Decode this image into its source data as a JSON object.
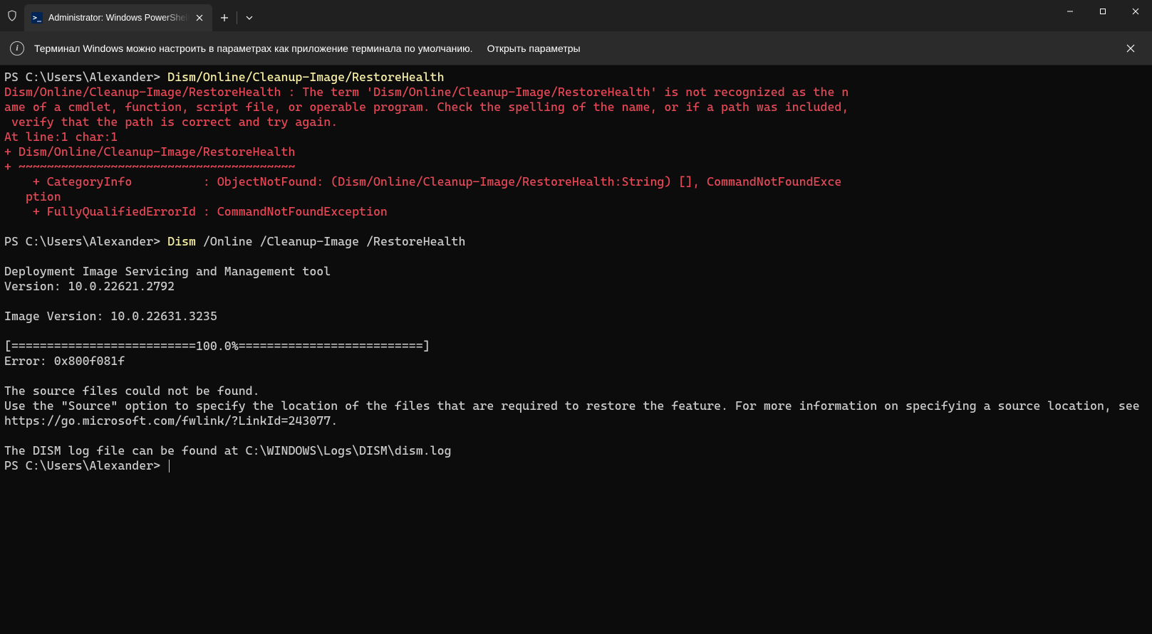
{
  "titleBar": {
    "tabTitle": "Administrator: Windows PowerShell"
  },
  "infoBar": {
    "message": "Терминал Windows можно настроить в параметрах как приложение терминала по умолчанию.",
    "link": "Открыть параметры"
  },
  "terminal": {
    "prompt1": "PS C:\\Users\\Alexander> ",
    "cmd1": "Dism/Online/Cleanup-Image/RestoreHealth",
    "error": "Dism/Online/Cleanup-Image/RestoreHealth : The term 'Dism/Online/Cleanup-Image/RestoreHealth' is not recognized as the n\name of a cmdlet, function, script file, or operable program. Check the spelling of the name, or if a path was included,\n verify that the path is correct and try again.\nAt line:1 char:1\n+ Dism/Online/Cleanup-Image/RestoreHealth\n+ ~~~~~~~~~~~~~~~~~~~~~~~~~~~~~~~~~~~~~~~\n    + CategoryInfo          : ObjectNotFound: (Dism/Online/Cleanup-Image/RestoreHealth:String) [], CommandNotFoundExce\n   ption\n    + FullyQualifiedErrorId : CommandNotFoundException\n ",
    "prompt2": "PS C:\\Users\\Alexander> ",
    "cmd2a": "Dism",
    "cmd2b": " /Online /Cleanup-Image /RestoreHealth",
    "output": "\nDeployment Image Servicing and Management tool\nVersion: 10.0.22621.2792\n\nImage Version: 10.0.22631.3235\n\n[==========================100.0%==========================]\nError: 0x800f081f\n\nThe source files could not be found.\nUse the \"Source\" option to specify the location of the files that are required to restore the feature. For more information on specifying a source location, see https://go.microsoft.com/fwlink/?LinkId=243077.\n\nThe DISM log file can be found at C:\\WINDOWS\\Logs\\DISM\\dism.log",
    "prompt3": "PS C:\\Users\\Alexander> "
  }
}
